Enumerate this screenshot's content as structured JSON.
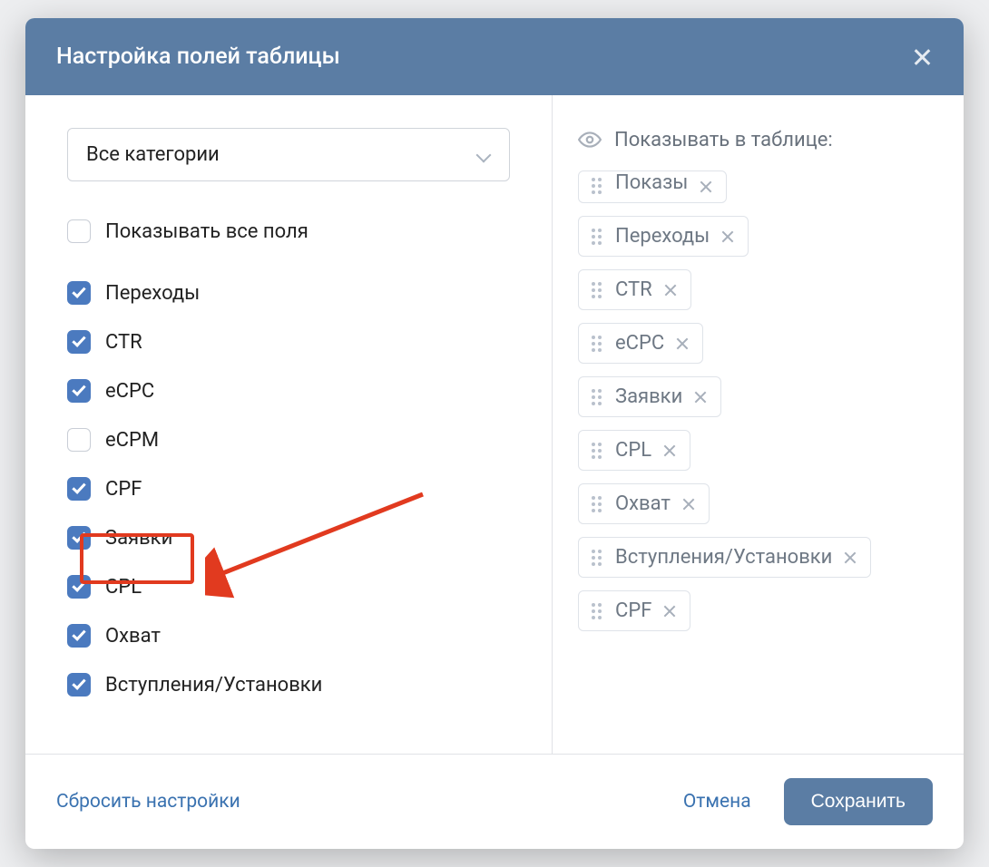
{
  "modal": {
    "title": "Настройка полей таблицы",
    "category_select": "Все категории",
    "show_all_label": "Показывать все поля",
    "fields": [
      {
        "label": "Переходы",
        "checked": true
      },
      {
        "label": "CTR",
        "checked": true
      },
      {
        "label": "eCPC",
        "checked": true
      },
      {
        "label": "eCPM",
        "checked": false
      },
      {
        "label": "CPF",
        "checked": true
      },
      {
        "label": "Заявки",
        "checked": true
      },
      {
        "label": "CPL",
        "checked": true
      },
      {
        "label": "Охват",
        "checked": true
      },
      {
        "label": "Вступления/Установки",
        "checked": true
      }
    ],
    "right_title": "Показывать в таблице:",
    "chips": [
      "Показы",
      "Переходы",
      "CTR",
      "eCPC",
      "Заявки",
      "CPL",
      "Охват",
      "Вступления/Установки",
      "CPF"
    ],
    "footer": {
      "reset": "Сбросить настройки",
      "cancel": "Отмена",
      "save": "Сохранить"
    }
  }
}
